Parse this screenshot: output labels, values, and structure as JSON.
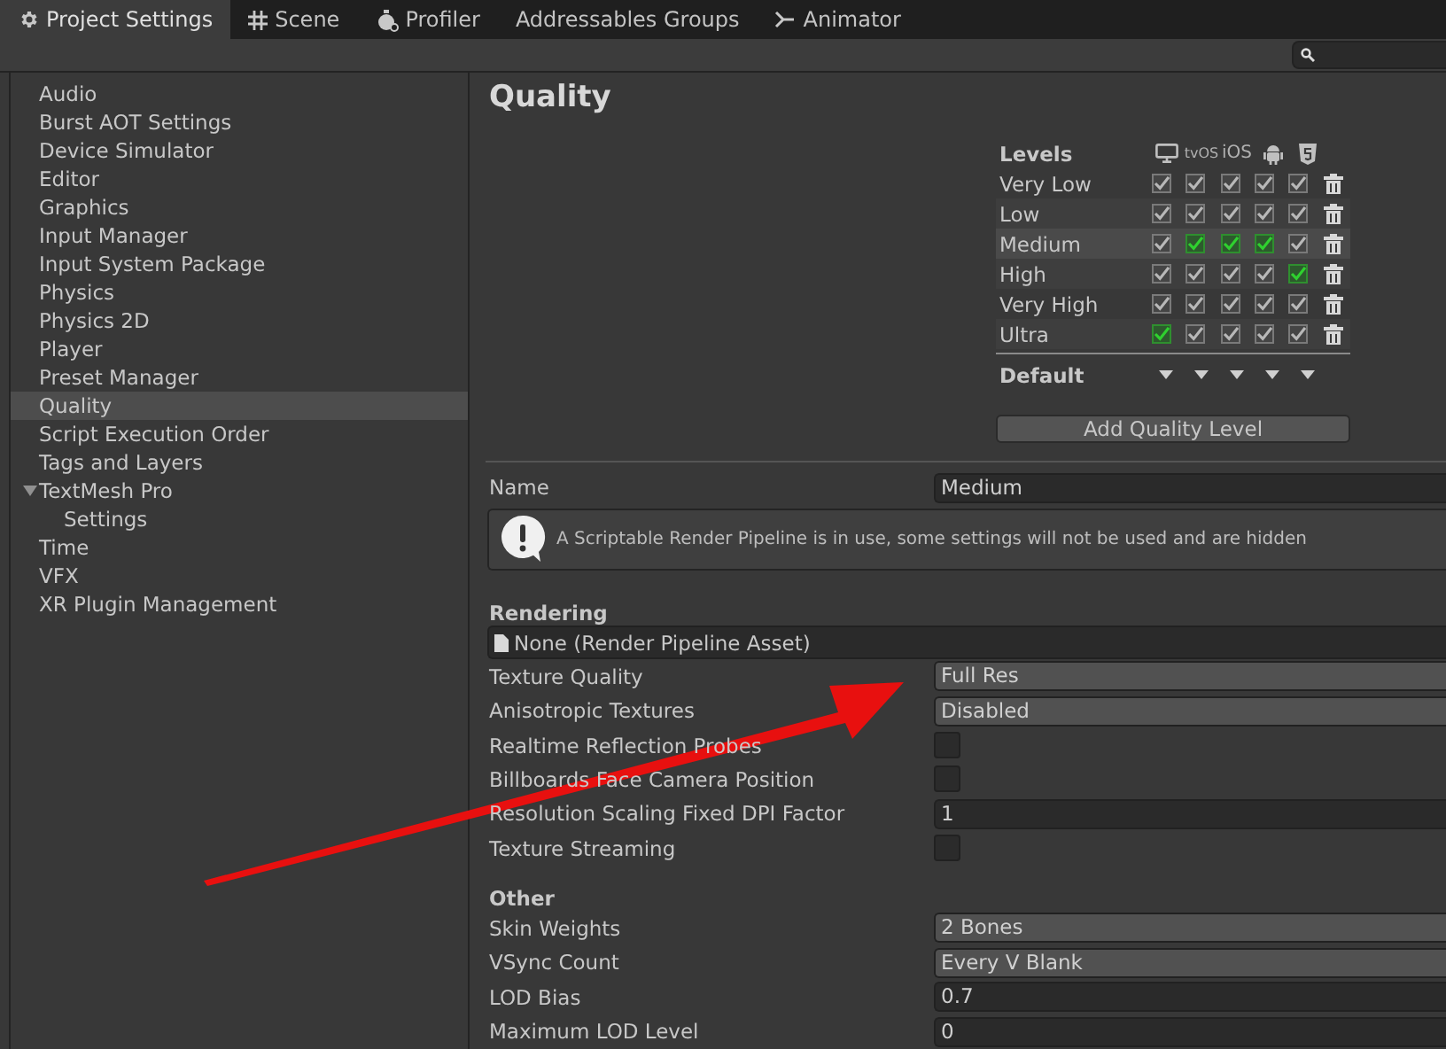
{
  "tabs": [
    {
      "label": "Project Settings",
      "selected": true
    },
    {
      "label": "Scene",
      "selected": false
    },
    {
      "label": "Profiler",
      "selected": false
    },
    {
      "label": "Addressables Groups",
      "selected": false
    },
    {
      "label": "Animator",
      "selected": false
    }
  ],
  "sidebar": {
    "items": [
      {
        "label": "Audio",
        "selected": false
      },
      {
        "label": "Burst AOT Settings",
        "selected": false
      },
      {
        "label": "Device Simulator",
        "selected": false
      },
      {
        "label": "Editor",
        "selected": false
      },
      {
        "label": "Graphics",
        "selected": false
      },
      {
        "label": "Input Manager",
        "selected": false
      },
      {
        "label": "Input System Package",
        "selected": false
      },
      {
        "label": "Physics",
        "selected": false
      },
      {
        "label": "Physics 2D",
        "selected": false
      },
      {
        "label": "Player",
        "selected": false
      },
      {
        "label": "Preset Manager",
        "selected": false
      },
      {
        "label": "Quality",
        "selected": true
      },
      {
        "label": "Script Execution Order",
        "selected": false
      },
      {
        "label": "Tags and Layers",
        "selected": false
      },
      {
        "label": "TextMesh Pro",
        "selected": false,
        "expanded": true,
        "children": [
          {
            "label": "Settings",
            "selected": false
          }
        ]
      },
      {
        "label": "Time",
        "selected": false
      },
      {
        "label": "VFX",
        "selected": false
      },
      {
        "label": "XR Plugin Management",
        "selected": false
      }
    ]
  },
  "title": "Quality",
  "levels": {
    "heading": "Levels",
    "default_label": "Default",
    "add_button": "Add Quality Level",
    "platforms": [
      {
        "kind": "icon"
      },
      {
        "kind": "text",
        "label": "tvOS"
      },
      {
        "kind": "text",
        "label": "iOS"
      },
      {
        "kind": "icon"
      },
      {
        "kind": "icon"
      }
    ],
    "rows": [
      {
        "name": "Very Low",
        "selected": false,
        "cells": [
          {
            "checked": true,
            "color": "#b8b8b8"
          },
          {
            "checked": true,
            "color": "#b8b8b8"
          },
          {
            "checked": true,
            "color": "#b8b8b8"
          },
          {
            "checked": true,
            "color": "#b8b8b8"
          },
          {
            "checked": true,
            "color": "#b8b8b8"
          }
        ]
      },
      {
        "name": "Low",
        "selected": false,
        "cells": [
          {
            "checked": true,
            "color": "#b8b8b8"
          },
          {
            "checked": true,
            "color": "#b8b8b8"
          },
          {
            "checked": true,
            "color": "#b8b8b8"
          },
          {
            "checked": true,
            "color": "#b8b8b8"
          },
          {
            "checked": true,
            "color": "#b8b8b8"
          }
        ]
      },
      {
        "name": "Medium",
        "selected": true,
        "cells": [
          {
            "checked": true,
            "color": "#b8b8b8"
          },
          {
            "checked": true,
            "color": "#2fd12f"
          },
          {
            "checked": true,
            "color": "#2fd12f"
          },
          {
            "checked": true,
            "color": "#2fd12f"
          },
          {
            "checked": true,
            "color": "#b8b8b8"
          }
        ]
      },
      {
        "name": "High",
        "selected": false,
        "cells": [
          {
            "checked": true,
            "color": "#b8b8b8"
          },
          {
            "checked": true,
            "color": "#b8b8b8"
          },
          {
            "checked": true,
            "color": "#b8b8b8"
          },
          {
            "checked": true,
            "color": "#b8b8b8"
          },
          {
            "checked": true,
            "color": "#2fd12f"
          }
        ]
      },
      {
        "name": "Very High",
        "selected": false,
        "cells": [
          {
            "checked": true,
            "color": "#b8b8b8"
          },
          {
            "checked": true,
            "color": "#b8b8b8"
          },
          {
            "checked": true,
            "color": "#b8b8b8"
          },
          {
            "checked": true,
            "color": "#b8b8b8"
          },
          {
            "checked": true,
            "color": "#b8b8b8"
          }
        ]
      },
      {
        "name": "Ultra",
        "selected": false,
        "cells": [
          {
            "checked": true,
            "color": "#2fd12f"
          },
          {
            "checked": true,
            "color": "#b8b8b8"
          },
          {
            "checked": true,
            "color": "#b8b8b8"
          },
          {
            "checked": true,
            "color": "#b8b8b8"
          },
          {
            "checked": true,
            "color": "#b8b8b8"
          }
        ]
      }
    ]
  },
  "name_field": {
    "label": "Name",
    "value": "Medium"
  },
  "help": "A Scriptable Render Pipeline is in use, some settings will not be used and are hidden",
  "sections": [
    {
      "title": "Rendering",
      "rows": [
        {
          "kind": "asset",
          "value": "None (Render Pipeline Asset)"
        },
        {
          "kind": "dropdown",
          "label": "Texture Quality",
          "value": "Full Res"
        },
        {
          "kind": "dropdown",
          "label": "Anisotropic Textures",
          "value": "Disabled"
        },
        {
          "kind": "checkbox",
          "label": "Realtime Reflection Probes",
          "checked": false
        },
        {
          "kind": "checkbox",
          "label": "Billboards Face Camera Position",
          "checked": false
        },
        {
          "kind": "number",
          "label": "Resolution Scaling Fixed DPI Factor",
          "value": "1"
        },
        {
          "kind": "checkbox",
          "label": "Texture Streaming",
          "checked": false
        }
      ]
    },
    {
      "title": "Other",
      "rows": [
        {
          "kind": "dropdown",
          "label": "Skin Weights",
          "value": "2 Bones"
        },
        {
          "kind": "dropdown",
          "label": "VSync Count",
          "value": "Every V Blank"
        },
        {
          "kind": "number",
          "label": "LOD Bias",
          "value": "0.7"
        },
        {
          "kind": "number",
          "label": "Maximum LOD Level",
          "value": "0"
        }
      ]
    }
  ]
}
